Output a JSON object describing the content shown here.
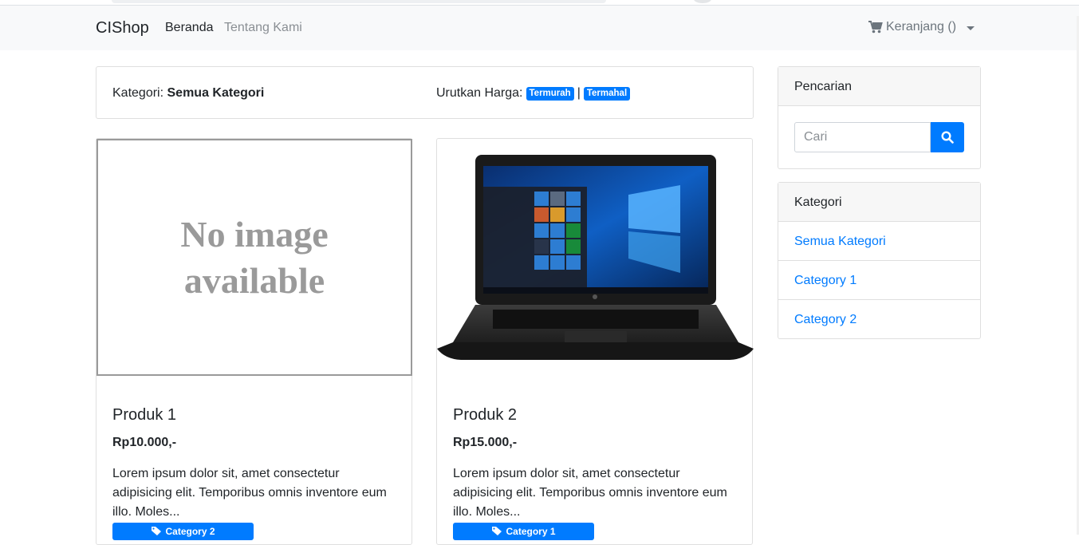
{
  "navbar": {
    "brand": "CIShop",
    "links": [
      {
        "label": "Beranda",
        "active": true
      },
      {
        "label": "Tentang Kami",
        "active": false
      }
    ],
    "cart_label": "Keranjang ()"
  },
  "filter": {
    "category_prefix": "Kategori:",
    "category_value": "Semua Kategori",
    "sort_prefix": "Urutkan Harga:",
    "sort_cheapest": "Termurah",
    "separator": "|",
    "sort_expensive": "Termahal"
  },
  "products": [
    {
      "image_text": "No image available",
      "name": "Produk 1",
      "price": "Rp10.000,-",
      "description": "Lorem ipsum dolor sit, amet consectetur adipisicing elit. Temporibus omnis inventore eum illo. Moles...",
      "category": "Category 2"
    },
    {
      "image_text": "",
      "name": "Produk 2",
      "price": "Rp15.000,-",
      "description": "Lorem ipsum dolor sit, amet consectetur adipisicing elit. Temporibus omnis inventore eum illo. Moles...",
      "category": "Category 1"
    }
  ],
  "search": {
    "header": "Pencarian",
    "placeholder": "Cari"
  },
  "categories": {
    "header": "Kategori",
    "items": [
      "Semua Kategori",
      "Category 1",
      "Category 2"
    ]
  },
  "colors": {
    "primary": "#007bff",
    "navbar_bg": "#f8f9fa",
    "muted": "#6c757d"
  }
}
